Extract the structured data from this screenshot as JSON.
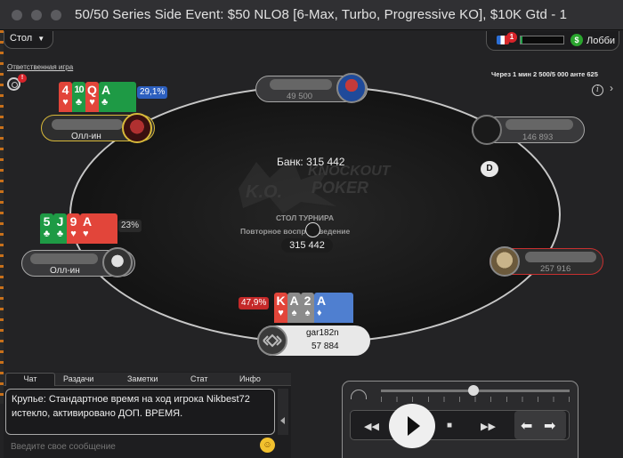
{
  "window": {
    "title": "50/50 Series Side Event: $50 NLO8 [6-Max, Turbo, Progressive KO], $10K Gtd - 1"
  },
  "topbar": {
    "table_menu_label": "Стол",
    "responsible_gaming_link": "Ответственная игра",
    "notification_count": "!",
    "lobby_label": "Лобби",
    "lobby_badge": "1",
    "lobby_progress_fraction": 0.05,
    "timer_text": "Через 1 мин 2 500/5 000 анте 625"
  },
  "table": {
    "pot_label": "Банк: 315 442",
    "table_name": "СТОЛ ТУРНИРА",
    "replay_text": "Повторное воспроизведение",
    "center_pot": "315 442",
    "dealer_button": "D",
    "logo_text": [
      "K.O.",
      "KNOCKOUT",
      "POKER"
    ]
  },
  "seats": [
    {
      "id": "top",
      "stack": "49 500"
    },
    {
      "id": "top-right",
      "stack": "146 893"
    },
    {
      "id": "right",
      "stack": "257 916"
    },
    {
      "id": "top-left",
      "status": "Олл-ин",
      "equity": "29,1%",
      "cards": [
        {
          "rank": "4",
          "suit": "♥",
          "color": "red"
        },
        {
          "rank": "10",
          "suit": "♣",
          "color": "green"
        },
        {
          "rank": "Q",
          "suit": "♥",
          "color": "red"
        },
        {
          "rank": "A",
          "suit": "♣",
          "color": "green"
        }
      ]
    },
    {
      "id": "left",
      "status": "Олл-ин",
      "equity": "23%",
      "cards": [
        {
          "rank": "5",
          "suit": "♣",
          "color": "green"
        },
        {
          "rank": "J",
          "suit": "♣",
          "color": "green"
        },
        {
          "rank": "9",
          "suit": "♥",
          "color": "red"
        },
        {
          "rank": "A",
          "suit": "♥",
          "color": "red"
        }
      ]
    },
    {
      "id": "hero",
      "name": "gar182n",
      "stack": "57 884",
      "equity": "47,9%",
      "cards": [
        {
          "rank": "K",
          "suit": "♥",
          "color": "red"
        },
        {
          "rank": "A",
          "suit": "♠",
          "color": "grey"
        },
        {
          "rank": "2",
          "suit": "♠",
          "color": "grey"
        },
        {
          "rank": "A",
          "suit": "♦",
          "color": "blue"
        }
      ]
    }
  ],
  "chat": {
    "tabs": [
      "Чат",
      "Раздачи",
      "Заметки",
      "Стат",
      "Инфо"
    ],
    "active_tab": "Чат",
    "message": "Крупье: Стандартное время на ход игрока Nikbest72 истекло, активировано ДОП. ВРЕМЯ.",
    "input_placeholder": "Введите свое сообщение"
  },
  "replayer": {
    "slider_position_fraction": 0.49,
    "buttons": [
      "rewind",
      "play",
      "stop",
      "fast-forward",
      "prev-hand",
      "next-hand"
    ]
  },
  "colors": {
    "felt_border": "#c7c7c7",
    "equity_blue": "#2c5fbf",
    "equity_red": "#c42929",
    "card_red": "#e2453a",
    "card_green": "#1e9a45",
    "card_blue": "#4f7fd0",
    "card_grey": "#8b8b8b"
  }
}
